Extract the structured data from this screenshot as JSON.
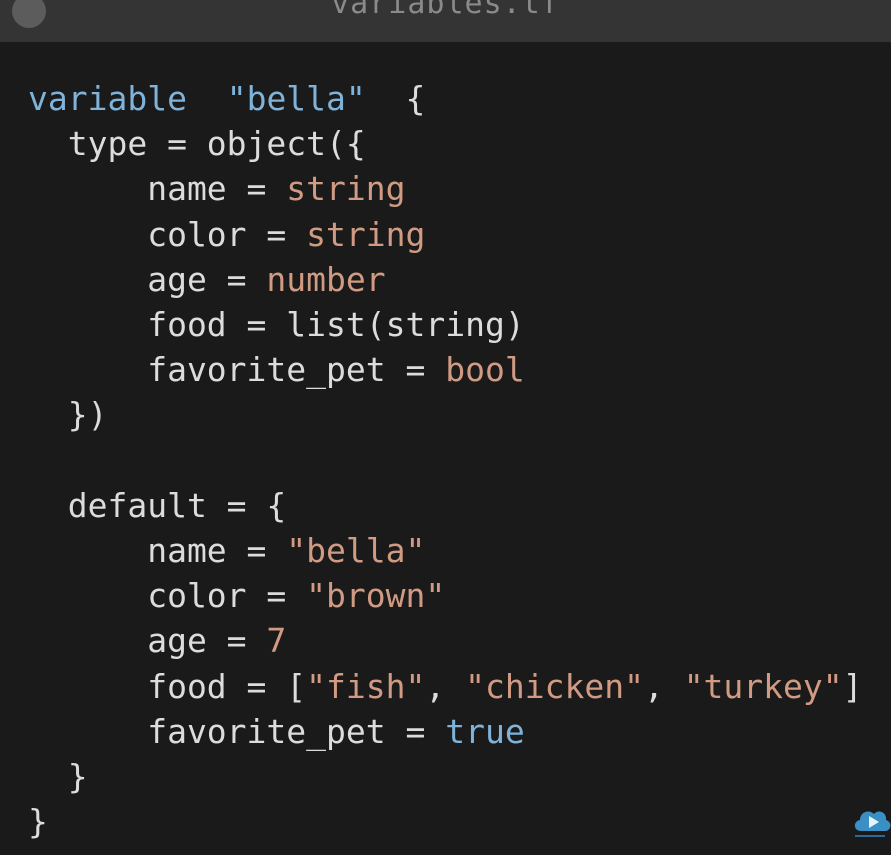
{
  "window": {
    "title": "variables.tf"
  },
  "editor": {
    "lines": [
      {
        "tokens": [
          {
            "text": "variable",
            "cls": "tok-kw"
          },
          {
            "text": "  ",
            "cls": "tok-punct"
          },
          {
            "text": "\"bella\"",
            "cls": "tok-kw"
          },
          {
            "text": "  {",
            "cls": "tok-punct"
          }
        ]
      },
      {
        "tokens": [
          {
            "text": "  type = object({",
            "cls": "tok-label"
          }
        ]
      },
      {
        "tokens": [
          {
            "text": "      name = ",
            "cls": "tok-label"
          },
          {
            "text": "string",
            "cls": "tok-type"
          }
        ]
      },
      {
        "tokens": [
          {
            "text": "      color = ",
            "cls": "tok-label"
          },
          {
            "text": "string",
            "cls": "tok-type"
          }
        ]
      },
      {
        "tokens": [
          {
            "text": "      age = ",
            "cls": "tok-label"
          },
          {
            "text": "number",
            "cls": "tok-type"
          }
        ]
      },
      {
        "tokens": [
          {
            "text": "      food = list(string)",
            "cls": "tok-label"
          }
        ]
      },
      {
        "tokens": [
          {
            "text": "      favorite_pet = ",
            "cls": "tok-label"
          },
          {
            "text": "bool",
            "cls": "tok-type"
          }
        ]
      },
      {
        "tokens": [
          {
            "text": "  })",
            "cls": "tok-label"
          }
        ]
      },
      {
        "tokens": []
      },
      {
        "tokens": [
          {
            "text": "  default = {",
            "cls": "tok-label"
          }
        ]
      },
      {
        "tokens": [
          {
            "text": "      name = ",
            "cls": "tok-label"
          },
          {
            "text": "\"bella\"",
            "cls": "tok-strval"
          }
        ]
      },
      {
        "tokens": [
          {
            "text": "      color = ",
            "cls": "tok-label"
          },
          {
            "text": "\"brown\"",
            "cls": "tok-strval"
          }
        ]
      },
      {
        "tokens": [
          {
            "text": "      age = ",
            "cls": "tok-label"
          },
          {
            "text": "7",
            "cls": "tok-num"
          }
        ]
      },
      {
        "tokens": [
          {
            "text": "      food = [",
            "cls": "tok-label"
          },
          {
            "text": "\"fish\"",
            "cls": "tok-strval"
          },
          {
            "text": ", ",
            "cls": "tok-label"
          },
          {
            "text": "\"chicken\"",
            "cls": "tok-strval"
          },
          {
            "text": ", ",
            "cls": "tok-label"
          },
          {
            "text": "\"turkey\"",
            "cls": "tok-strval"
          },
          {
            "text": "]",
            "cls": "tok-label"
          }
        ]
      },
      {
        "tokens": [
          {
            "text": "      favorite_pet = ",
            "cls": "tok-label"
          },
          {
            "text": "true",
            "cls": "tok-bool"
          }
        ]
      },
      {
        "tokens": [
          {
            "text": "  }",
            "cls": "tok-label"
          }
        ]
      },
      {
        "tokens": [
          {
            "text": "}",
            "cls": "tok-label"
          }
        ]
      }
    ]
  },
  "icons": {
    "close_button": "close-icon",
    "watermark": "cloud-play-logo-icon"
  },
  "colors": {
    "background": "#1a1a1a",
    "titlebar": "#343434",
    "keyword": "#7fb3da",
    "type": "#d19a82",
    "text": "#dcdcdc"
  }
}
